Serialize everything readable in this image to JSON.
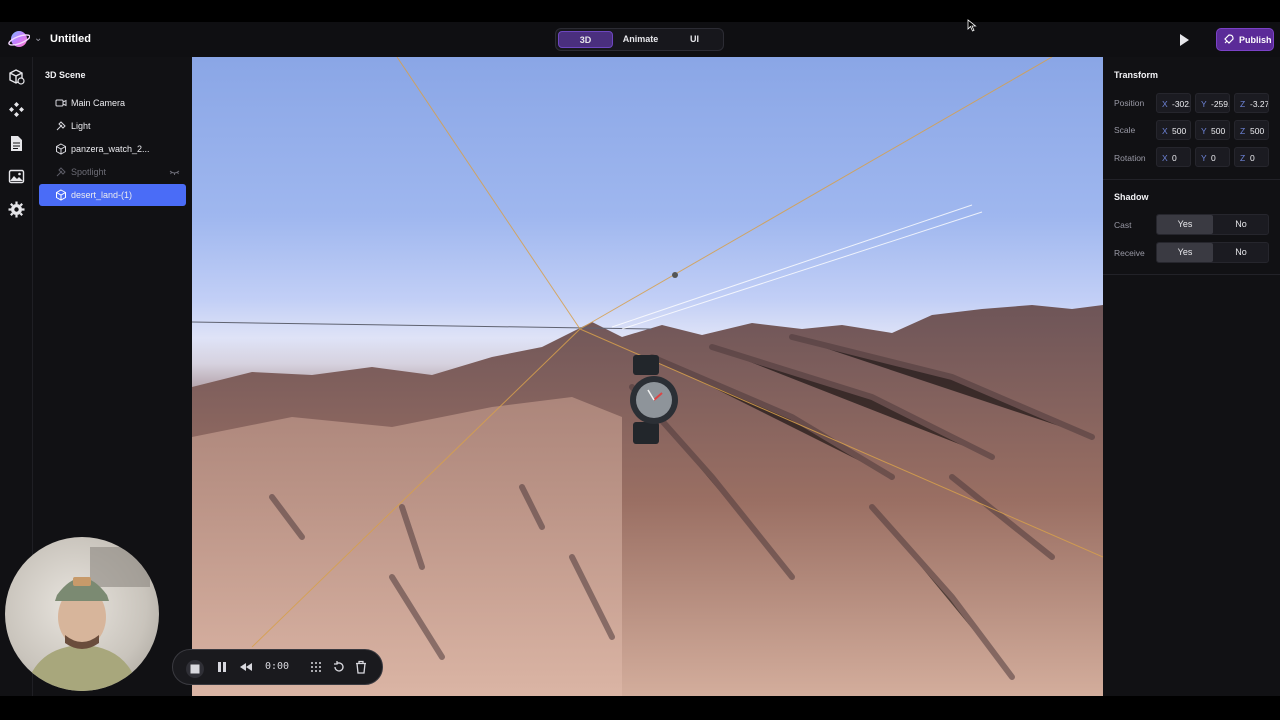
{
  "app": {
    "document_title": "Untitled",
    "modes": [
      {
        "label": "3D",
        "active": true
      },
      {
        "label": "Animate",
        "active": false
      },
      {
        "label": "UI",
        "active": false
      }
    ],
    "publish_label": "Publish",
    "accent_color": "#4a6cf7",
    "brand_color": "#5b2b98"
  },
  "left_rail": {
    "icons": [
      "objects-icon",
      "components-icon",
      "document-icon",
      "image-icon",
      "settings-icon"
    ]
  },
  "scene_panel": {
    "title": "3D Scene",
    "items": [
      {
        "label": "Main Camera",
        "icon": "camera-icon",
        "selected": false,
        "dim": false
      },
      {
        "label": "Light",
        "icon": "light-icon",
        "selected": false,
        "dim": false
      },
      {
        "label": "panzera_watch_2...",
        "icon": "cube-icon",
        "selected": false,
        "dim": false
      },
      {
        "label": "Spotlight",
        "icon": "spotlight-icon",
        "selected": false,
        "dim": true
      },
      {
        "label": "desert_land-(1)",
        "icon": "cube-icon",
        "selected": true,
        "dim": false
      }
    ]
  },
  "properties": {
    "transform_title": "Transform",
    "position": {
      "label": "Position",
      "x": "-302.",
      "y": "-259.",
      "z": "-3.27"
    },
    "scale": {
      "label": "Scale",
      "x": "500",
      "y": "500",
      "z": "500"
    },
    "rotation": {
      "label": "Rotation",
      "x": "0",
      "y": "0",
      "z": "0"
    },
    "axis_labels": {
      "x": "X",
      "y": "Y",
      "z": "Z"
    },
    "shadow_title": "Shadow",
    "cast": {
      "label": "Cast",
      "yes": "Yes",
      "no": "No",
      "value": "Yes"
    },
    "receive": {
      "label": "Receive",
      "yes": "Yes",
      "no": "No",
      "value": "Yes"
    }
  },
  "playback": {
    "time": "0:00"
  }
}
